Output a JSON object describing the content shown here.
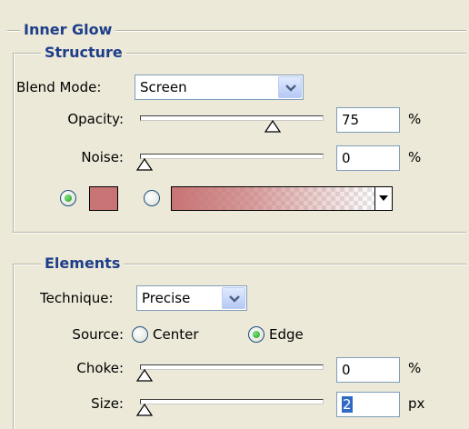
{
  "groups": {
    "inner_glow": "Inner Glow",
    "structure": "Structure",
    "elements": "Elements"
  },
  "structure": {
    "blend_mode_label": "Blend Mode:",
    "blend_mode_value": "Screen",
    "opacity_label": "Opacity:",
    "opacity_value": "75",
    "opacity_unit": "%",
    "opacity_level": 0.75,
    "noise_label": "Noise:",
    "noise_value": "0",
    "noise_unit": "%",
    "noise_level": 0.0,
    "color_radio_selected": true,
    "gradient_radio_selected": false,
    "glow_color": "#c87474"
  },
  "elements": {
    "technique_label": "Technique:",
    "technique_value": "Precise",
    "source_label": "Source:",
    "source_center": "Center",
    "source_edge": "Edge",
    "source_selected": "Edge",
    "choke_label": "Choke:",
    "choke_value": "0",
    "choke_unit": "%",
    "choke_level": 0.0,
    "size_label": "Size:",
    "size_value": "2",
    "size_unit": "px",
    "size_level": 0.0
  },
  "icons": {
    "dropdown": "chevron-down-icon",
    "slider_thumb": "triangle-thumb-icon"
  }
}
